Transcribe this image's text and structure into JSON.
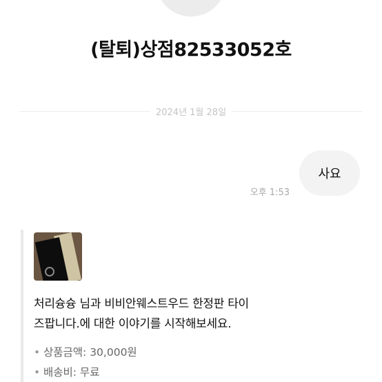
{
  "profile": {
    "name": "(탈퇴)상점82533052호"
  },
  "chat": {
    "date": "2024년 1월 28일",
    "messages": [
      {
        "text": "사요",
        "time": "오후 1:53",
        "side": "right"
      }
    ]
  },
  "product_card": {
    "image_icon": "product-thumbnail",
    "message": "처리슝슝 님과 비비안웨스트우드 한정판 타이즈팝니다.에 대한 이야기를 시작해보세요.",
    "message_line1": "처리슝슝 님과 비비안웨스트우드 한정판 타이",
    "message_line2": "즈팝니다.에 대한 이야기를 시작해보세요.",
    "price_label": "상품금액: 30,000원",
    "shipping_label": "배송비: 무료",
    "bullet": "•"
  },
  "colors": {
    "bubble": "#f3f3f3",
    "divider": "#ececec",
    "card_border": "#e9e9e9",
    "muted_text": "#666666"
  }
}
